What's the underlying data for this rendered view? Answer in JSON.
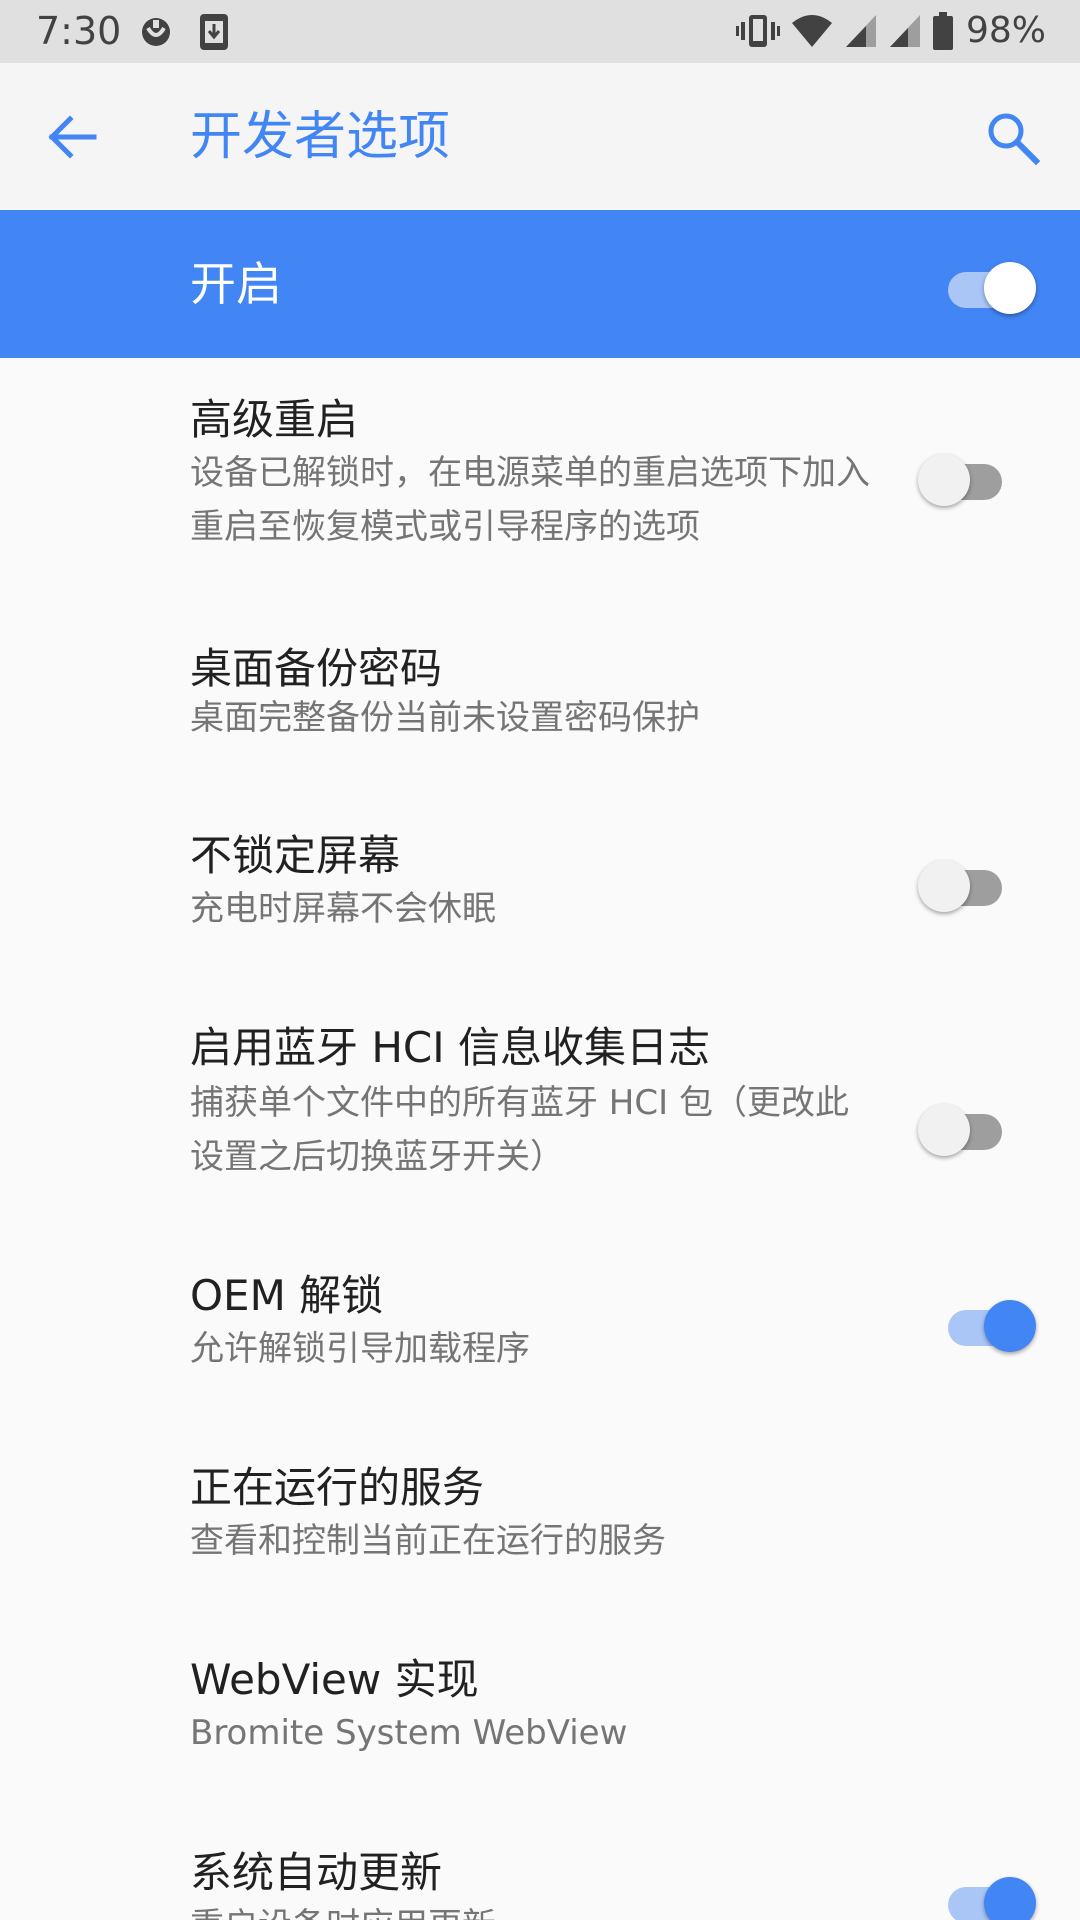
{
  "status_bar": {
    "time": "7:30",
    "battery_pct": "98%"
  },
  "toolbar": {
    "title": "开发者选项"
  },
  "master_switch": {
    "label": "开启",
    "state": "on"
  },
  "preferences": [
    {
      "title": "高级重启",
      "summary": "设备已解锁时，在电源菜单的重启选项下加入重启至恢复模式或引导程序的选项",
      "switch": "off"
    },
    {
      "title": "桌面备份密码",
      "summary": "桌面完整备份当前未设置密码保护",
      "switch": null
    },
    {
      "title": "不锁定屏幕",
      "summary": "充电时屏幕不会休眠",
      "switch": "off"
    },
    {
      "title": "启用蓝牙 HCI 信息收集日志",
      "summary": "捕获单个文件中的所有蓝牙 HCI 包（更改此设置之后切换蓝牙开关）",
      "switch": "off"
    },
    {
      "title": "OEM 解锁",
      "summary": "允许解锁引导加载程序",
      "switch": "on"
    },
    {
      "title": "正在运行的服务",
      "summary": "查看和控制当前正在运行的服务",
      "switch": null
    },
    {
      "title": "WebView 实现",
      "summary": "Bromite System WebView",
      "switch": null
    },
    {
      "title": "系统自动更新",
      "summary": "重启设备时应用更新",
      "switch": "on"
    }
  ],
  "colors": {
    "accent": "#4285f4",
    "status_bar_bg": "#e0e0e0",
    "toolbar_bg": "#f5f5f5",
    "page_bg": "#fafafa",
    "summary_text": "#757575"
  }
}
